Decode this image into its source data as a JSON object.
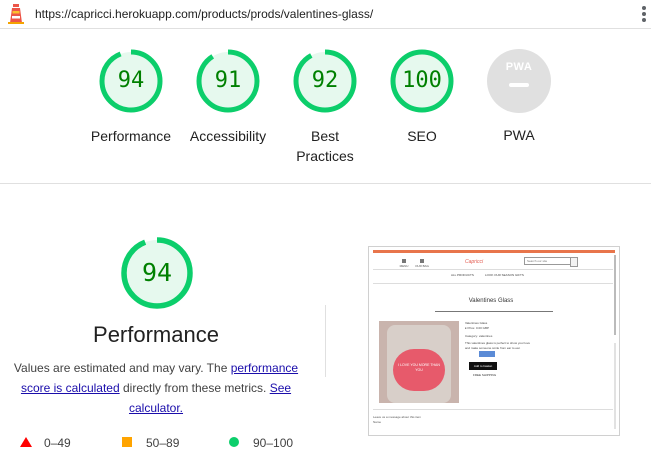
{
  "topbar": {
    "url": "https://capricci.herokuapp.com/products/prods/valentines-glass/"
  },
  "categories": [
    {
      "label": "Performance",
      "score": 94
    },
    {
      "label": "Accessibility",
      "score": 91
    },
    {
      "label": "Best Practices",
      "score": 92
    },
    {
      "label": "SEO",
      "score": 100
    }
  ],
  "pwa": {
    "label": "PWA",
    "badge": "PWA"
  },
  "performance": {
    "score": 94,
    "title": "Performance",
    "desc_prefix": "Values are estimated and may vary. The ",
    "link_calc": "performance score is calculated",
    "desc_middle": " directly from these metrics. ",
    "link_see": "See calculator."
  },
  "legend": {
    "fail": "0–49",
    "average": "50–89",
    "pass": "90–100"
  },
  "colors": {
    "pass": "#0cce6b",
    "pass_text": "#008000",
    "pass_bg": "#e6f9ee",
    "average": "#ffa400",
    "fail": "#ff0000",
    "link": "#1a0dab"
  },
  "thumbnail": {
    "logo": "Capricci",
    "search_placeholder": "Search our site",
    "nav_left": "MENU",
    "nav_right": "OUR BAG",
    "menu_all": "ALL PRODUCTS",
    "menu_season": "LOOK OUR SEASON GIFTS",
    "product_title": "Valentines Glass",
    "info_name": "Valentines Glass",
    "info_price": "£ Price: 0.00 GBP",
    "info_category": "Category: valentines",
    "info_desc1": "This valentines glass is perfect to show your love",
    "info_desc2": "and make someone smile from ear to ear.",
    "buy_label": "Add to basket",
    "free_shipping": "FREE SHIPPING",
    "heart_text": "I LOVE YOU MORE THAN YOU",
    "footer1": "Leave us a message about this item",
    "footer2": "Name"
  }
}
